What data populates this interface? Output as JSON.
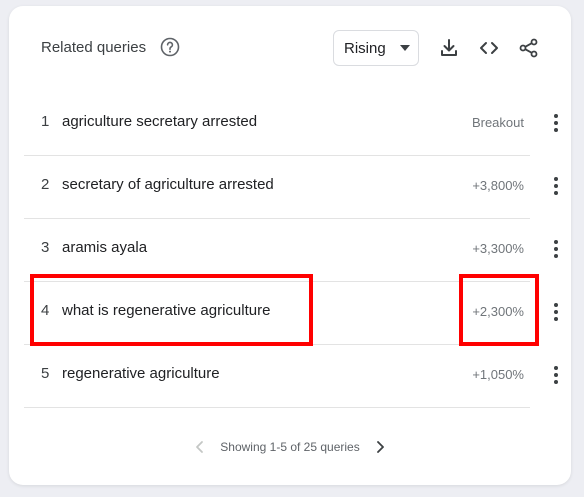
{
  "header": {
    "title": "Related queries",
    "filter_value": "Rising"
  },
  "icons": [
    "help-icon",
    "caret-down-icon",
    "download-icon",
    "embed-icon",
    "share-icon",
    "more-vert-icon",
    "chevron-left-icon",
    "chevron-right-icon"
  ],
  "rows": [
    {
      "rank": "1",
      "query": "agriculture secretary arrested",
      "value": "Breakout"
    },
    {
      "rank": "2",
      "query": "secretary of agriculture arrested",
      "value": "+3,800%"
    },
    {
      "rank": "3",
      "query": "aramis ayala",
      "value": "+3,300%"
    },
    {
      "rank": "4",
      "query": "what is regenerative agriculture",
      "value": "+2,300%"
    },
    {
      "rank": "5",
      "query": "regenerative agriculture",
      "value": "+1,050%"
    }
  ],
  "pagination": {
    "text": "Showing 1-5 of 25 queries"
  },
  "colors": {
    "highlight": "#ff0000",
    "background": "#edeef3",
    "card": "#ffffff"
  }
}
